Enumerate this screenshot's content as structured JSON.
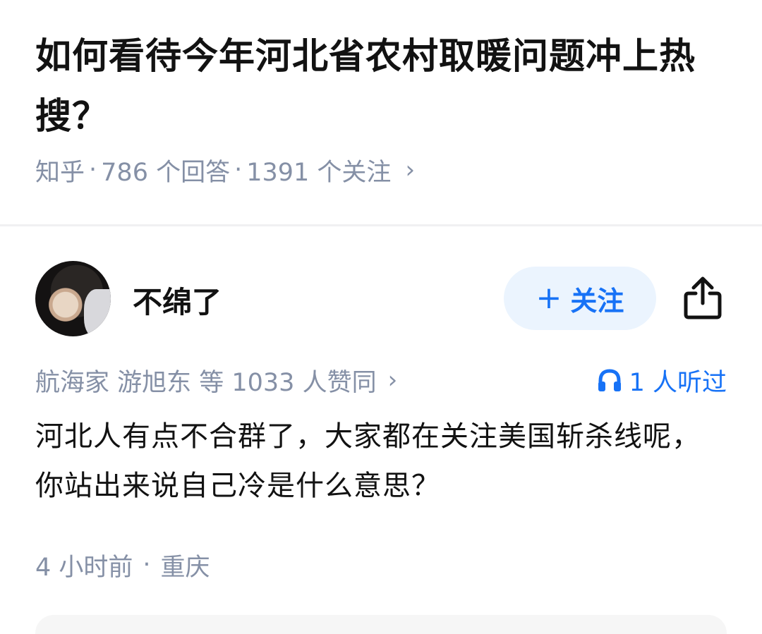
{
  "question": {
    "title": "如何看待今年河北省农村取暖问题冲上热搜？",
    "source": "知乎",
    "sep": "·",
    "answers": "786 个回答",
    "follows": "1391 个关注",
    "chevron": "›"
  },
  "answer": {
    "author_name": "不绵了",
    "follow_plus": "+",
    "follow_label": "关注",
    "upvote_text": "航海家 游旭东 等 1033 人赞同",
    "upvote_chevron": "›",
    "listen_text": "1 人听过",
    "content": "河北人有点不合群了，大家都在关注美国斩杀线呢，你站出来说自己冷是什么意思？",
    "time": "4 小时前",
    "time_sep": "·",
    "location": "重庆"
  },
  "icons": {
    "share": "share-icon",
    "headphones": "headphones-icon"
  },
  "colors": {
    "accent": "#1772f6",
    "follow_bg": "#ebf4fe",
    "meta_gray": "#8590a6",
    "text": "#121212"
  }
}
